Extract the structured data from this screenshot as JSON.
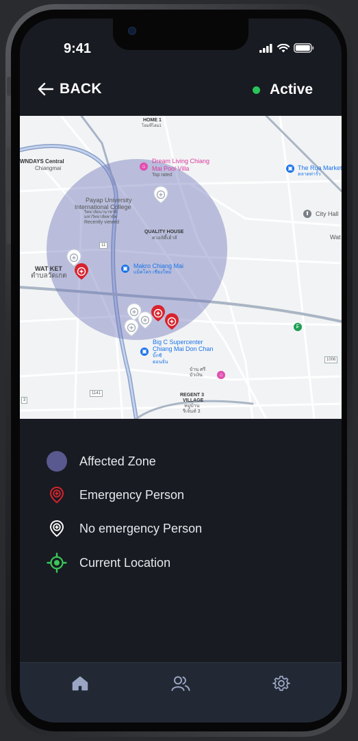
{
  "status_bar": {
    "time": "9:41",
    "icons": [
      "signal-icon",
      "wifi-icon",
      "battery-icon"
    ]
  },
  "header": {
    "back_label": "BACK",
    "status_label": "Active",
    "status_color": "#29c45a"
  },
  "map": {
    "labels": {
      "home1": "HOME 1",
      "home1_th": "โฮมทีไฮม1",
      "central": "WNDAYS Central",
      "central2": "Chiangmai",
      "dream": "Dream Living Chiang",
      "dream2": "Mai Pool Villa",
      "dream3": "Top rated",
      "thrua": "The Rua Market",
      "thrua2": "ตลาดท่ารั้ว",
      "payap": "Payap University",
      "payap2": "International College",
      "payap3": "วิทยาลัยนานาชาติ",
      "payap4": "มหาวิทยาลัยพายัพ",
      "payap5": "Recently viewed",
      "cityhall": "City Hall",
      "wat": "Wat",
      "quality": "QUALITY HOUSE",
      "quality2": "ควอลิตี้เฮ้าส์",
      "watket": "WAT KET",
      "watket2": "ตำบลวัดเกต",
      "makro": "Makro Chiang Mai",
      "makro2": "แม็คโคร เชียงใหม่",
      "bigc": "Big C Supercenter",
      "bigc2": "Chiang Mai Don Chan",
      "bigc3": "บิ๊กซี",
      "bigc4": "ดอนจั่น",
      "bansri": "บ้าน ศรี",
      "bansri2": "บัวเงิน",
      "regent": "REGENT 3",
      "regent2": "VILLAGE",
      "regent3": "หมู่บ้าน",
      "regent4": "รีเจ้นท์ 3",
      "road_1141": "1141",
      "road_11": "11",
      "road_1006": "1006",
      "road_3": "3"
    },
    "colors": {
      "zone": "#6b72b8",
      "emergency": "#d9232e",
      "no_emergency": "#ffffff"
    }
  },
  "legend": {
    "items": [
      {
        "label": "Affected Zone",
        "icon": "affected-zone-icon",
        "color": "#59588f"
      },
      {
        "label": "Emergency Person",
        "icon": "emergency-pin-icon",
        "color": "#d9232e"
      },
      {
        "label": "No emergency Person",
        "icon": "no-emergency-pin-icon",
        "color": "#ffffff"
      },
      {
        "label": "Current Location",
        "icon": "current-location-icon",
        "color": "#3bc85a"
      }
    ]
  },
  "tabbar": {
    "tabs": [
      "home-icon",
      "people-icon",
      "gear-icon"
    ],
    "icon_color": "#9aa6c4"
  }
}
